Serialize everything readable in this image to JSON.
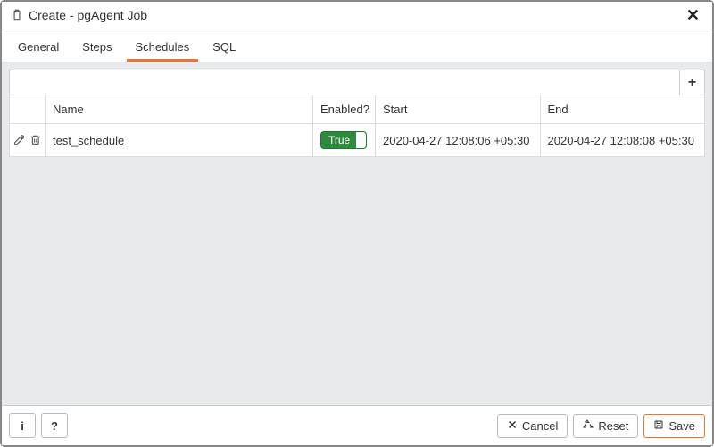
{
  "dialog": {
    "title": "Create - pgAgent Job"
  },
  "tabs": [
    {
      "label": "General",
      "active": false
    },
    {
      "label": "Steps",
      "active": false
    },
    {
      "label": "Schedules",
      "active": true
    },
    {
      "label": "SQL",
      "active": false
    }
  ],
  "grid": {
    "columns": {
      "name": "Name",
      "enabled": "Enabled?",
      "start": "Start",
      "end": "End"
    },
    "rows": [
      {
        "name": "test_schedule",
        "enabled_label": "True",
        "enabled": true,
        "start": "2020-04-27 12:08:06 +05:30",
        "end": "2020-04-27 12:08:08 +05:30"
      }
    ]
  },
  "footer": {
    "cancel": "Cancel",
    "reset": "Reset",
    "save": "Save"
  }
}
